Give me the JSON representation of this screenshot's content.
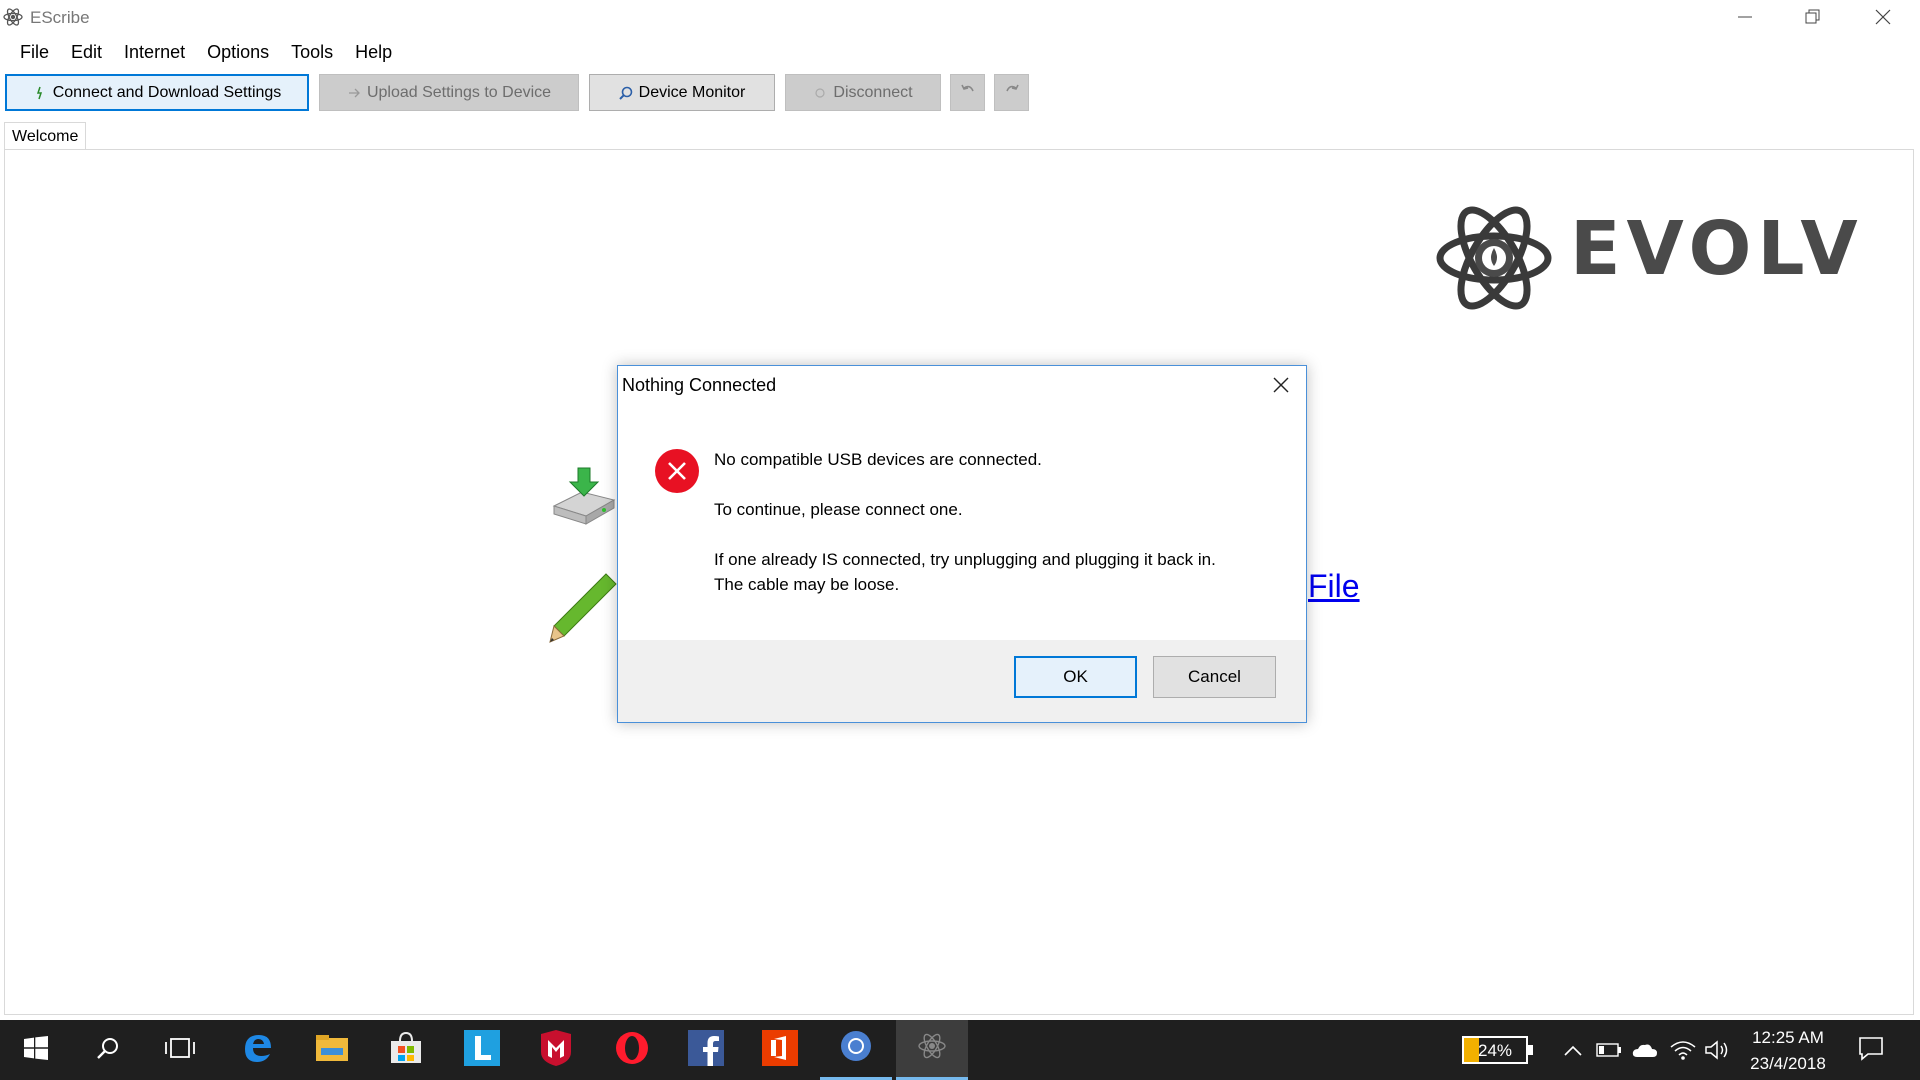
{
  "window": {
    "title": "EScribe",
    "icon": "atom-icon",
    "controls": [
      "minimize-icon",
      "restore-icon",
      "close-icon"
    ]
  },
  "menu": {
    "items": [
      "File",
      "Edit",
      "Internet",
      "Options",
      "Tools",
      "Help"
    ]
  },
  "toolbar": {
    "connect_label": "Connect and Download Settings",
    "upload_label": "Upload Settings to Device",
    "monitor_label": "Device Monitor",
    "disconnect_label": "Disconnect",
    "undo_icon": "undo-icon",
    "redo_icon": "redo-icon"
  },
  "tabs": {
    "items": [
      "Welcome"
    ],
    "active": "Welcome"
  },
  "welcome": {
    "brand": "EVOLV",
    "link_fragment": "File"
  },
  "dialog": {
    "title": "Nothing Connected",
    "icon": "error-icon",
    "line1": "No compatible USB devices are connected.",
    "line2": "To continue, please connect one.",
    "line3": "If one already IS connected, try unplugging and plugging it back in.",
    "line4": "The cable may be loose.",
    "ok_label": "OK",
    "cancel_label": "Cancel"
  },
  "taskbar": {
    "apps": [
      "start-icon",
      "search-icon",
      "task-view-icon",
      "edge-icon",
      "file-explorer-icon",
      "store-icon",
      "l-app-icon",
      "mcafee-icon",
      "opera-icon",
      "facebook-icon",
      "office-icon",
      "chrome-icon",
      "escribe-icon"
    ],
    "battery_percent": "24%",
    "battery_level": 0.24,
    "time": "12:25 AM",
    "date": "23/4/2018"
  },
  "colors": {
    "accent": "#0078d7",
    "error_red": "#e81123",
    "link": "#0000ee",
    "taskbar": "#1f1f1f",
    "battery": "#f2b000"
  }
}
